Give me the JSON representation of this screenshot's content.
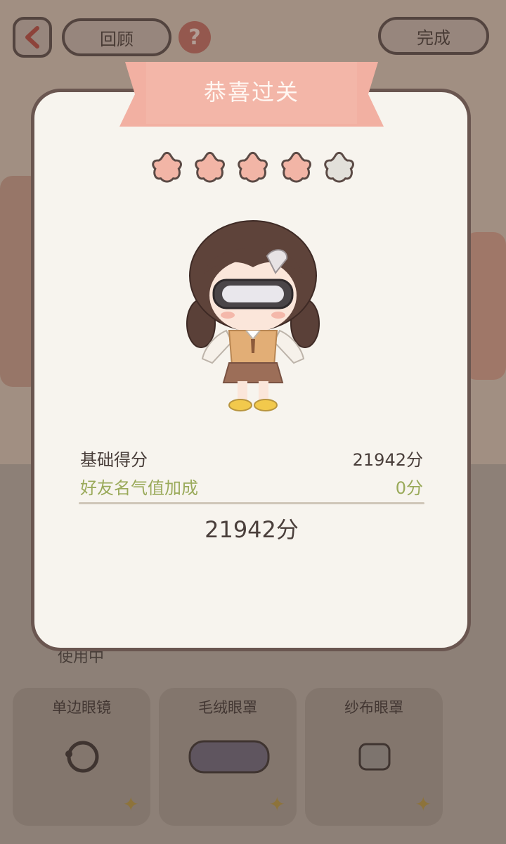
{
  "header": {
    "back_icon": "chevron-left-icon",
    "review_label": "回顾",
    "help_icon": "question-mark-icon",
    "done_label": "完成"
  },
  "dialog": {
    "title": "恭喜过关",
    "stars_filled": 4,
    "stars_total": 5,
    "colors": {
      "star_filled": "#f2b5a6",
      "star_empty": "#e2e0da",
      "ribbon": "#f2b0a2",
      "bonus_text": "#9aaa5a"
    },
    "rows": [
      {
        "label": "基础得分",
        "value": "21942分"
      },
      {
        "label": "好友名气值加成",
        "value": "0分"
      }
    ],
    "total": "21942分"
  },
  "items": {
    "in_use_label": "使用中",
    "cards": [
      {
        "name": "单边眼镜",
        "icon": "monocle-icon"
      },
      {
        "name": "毛绒眼罩",
        "icon": "plush-eye-mask-icon"
      },
      {
        "name": "纱布眼罩",
        "icon": "gauze-eye-patch-icon"
      }
    ]
  }
}
